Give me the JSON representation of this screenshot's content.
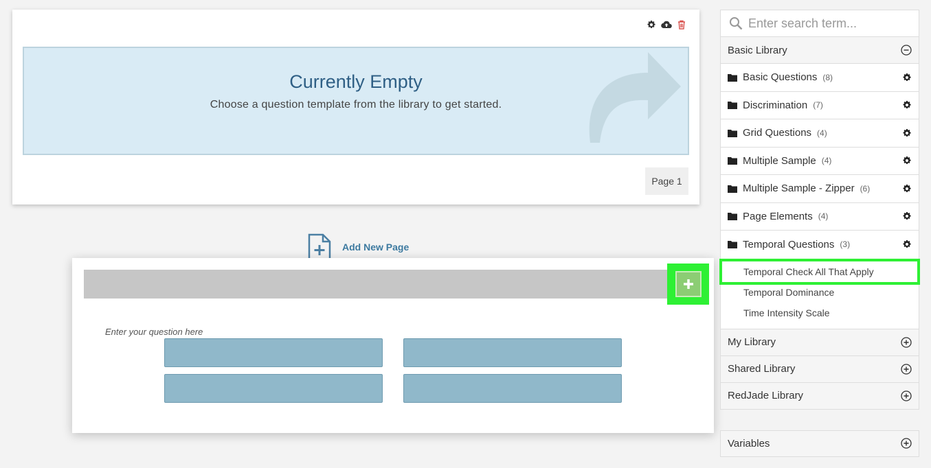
{
  "page": {
    "empty_title": "Currently Empty",
    "empty_subtitle": "Choose a question template from the library to get started.",
    "page_label": "Page 1",
    "tools": [
      "gear-icon",
      "cloud-upload-icon",
      "trash-icon"
    ]
  },
  "add_page": {
    "label": "Add New Page"
  },
  "preview": {
    "question_placeholder": "Enter your question here",
    "plus_label": "+"
  },
  "sidebar": {
    "search_placeholder": "Enter search term...",
    "basic_library": "Basic Library",
    "folders": [
      {
        "name": "Basic Questions",
        "count": "(8)"
      },
      {
        "name": "Discrimination",
        "count": "(7)"
      },
      {
        "name": "Grid Questions",
        "count": "(4)"
      },
      {
        "name": "Multiple Sample",
        "count": "(4)"
      },
      {
        "name": "Multiple Sample - Zipper",
        "count": "(6)"
      },
      {
        "name": "Page Elements",
        "count": "(4)"
      },
      {
        "name": "Temporal Questions",
        "count": "(3)"
      }
    ],
    "temporal_items": [
      "Temporal Check All That Apply",
      "Temporal Dominance",
      "Time Intensity Scale"
    ],
    "libraries": [
      "My Library",
      "Shared Library",
      "RedJade Library"
    ],
    "variables": "Variables"
  },
  "colors": {
    "highlight": "#2ef034",
    "empty_bg": "#d9ebf5",
    "title_blue": "#2f5f85",
    "answer_bg": "#90b8ca",
    "plus_green": "#8ccd74",
    "trash_red": "#d9534f"
  }
}
